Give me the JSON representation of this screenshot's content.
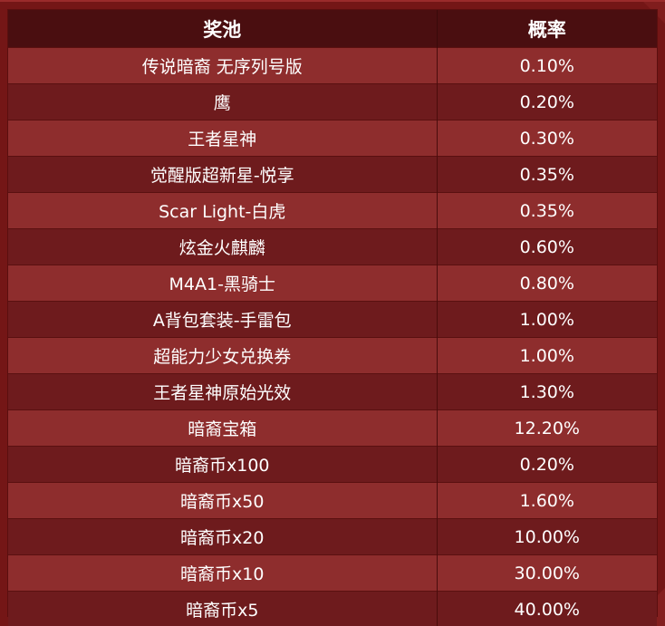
{
  "table": {
    "headers": {
      "name": "奖池",
      "prob": "概率"
    },
    "rows": [
      {
        "name": "传说暗裔 无序列号版",
        "prob": "0.10%"
      },
      {
        "name": "鹰",
        "prob": "0.20%"
      },
      {
        "name": "王者星神",
        "prob": "0.30%"
      },
      {
        "name": "觉醒版超新星-悦享",
        "prob": "0.35%"
      },
      {
        "name": "Scar Light-白虎",
        "prob": "0.35%"
      },
      {
        "name": "炫金火麒麟",
        "prob": "0.60%"
      },
      {
        "name": "M4A1-黑骑士",
        "prob": "0.80%"
      },
      {
        "name": "A背包套装-手雷包",
        "prob": "1.00%"
      },
      {
        "name": "超能力少女兑换券",
        "prob": "1.00%"
      },
      {
        "name": "王者星神原始光效",
        "prob": "1.30%"
      },
      {
        "name": "暗裔宝箱",
        "prob": "12.20%"
      },
      {
        "name": "暗裔币x100",
        "prob": "0.20%"
      },
      {
        "name": "暗裔币x50",
        "prob": "1.60%"
      },
      {
        "name": "暗裔币x20",
        "prob": "10.00%"
      },
      {
        "name": "暗裔币x10",
        "prob": "30.00%"
      },
      {
        "name": "暗裔币x5",
        "prob": "40.00%"
      }
    ]
  },
  "colors": {
    "header_bg": "#4a0e10",
    "row_light": "#8e2d2d",
    "row_dark": "#6e1b1d",
    "text": "#ffffff"
  }
}
